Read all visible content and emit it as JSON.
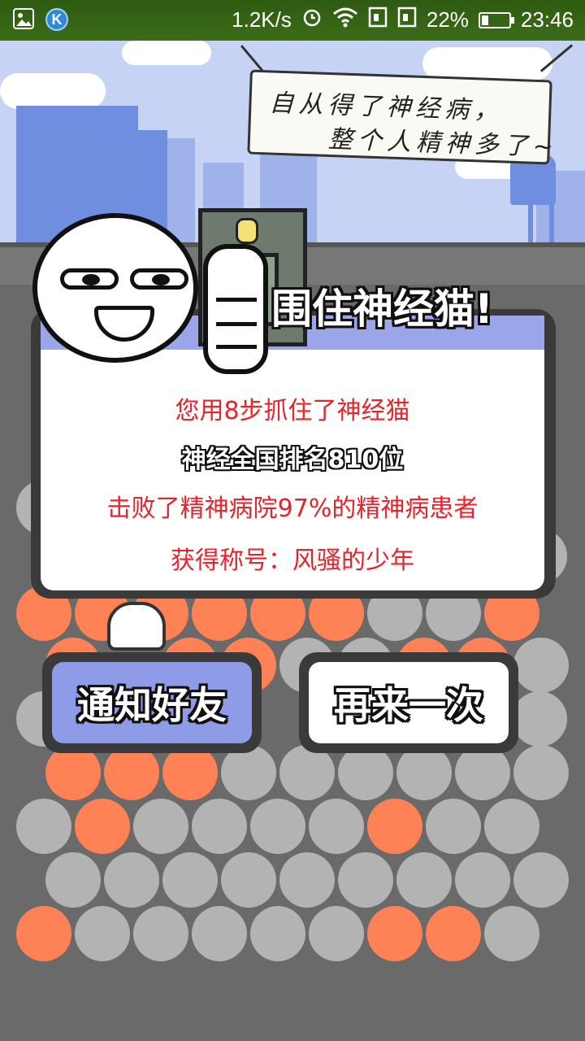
{
  "status_bar": {
    "network_speed": "1.2K/s",
    "battery_percent": "22%",
    "time": "23:46",
    "left_icons": [
      "gallery-icon",
      "k-app-icon"
    ],
    "right_icons": [
      "alarm-icon",
      "wifi-icon",
      "sim1-icon",
      "sim2-icon",
      "battery-charging-icon"
    ]
  },
  "banner": {
    "line1": "自从得了神经病，",
    "line2": "整个人精神多了~"
  },
  "dialog": {
    "title": "围住神经猫!",
    "steps_text": "您用8步抓住了神经猫",
    "rank_text": "神经全国排名810位",
    "beat_text": "击败了精神病院97%的精神病患者",
    "honor_text": "获得称号：风骚的少年"
  },
  "buttons": {
    "notify_friends": "通知好友",
    "play_again": "再来一次"
  },
  "colors": {
    "blocked": "#ff8257",
    "empty": "#b3b3b3",
    "accent_blue": "#8e9be6",
    "text_red": "#e8232b"
  }
}
